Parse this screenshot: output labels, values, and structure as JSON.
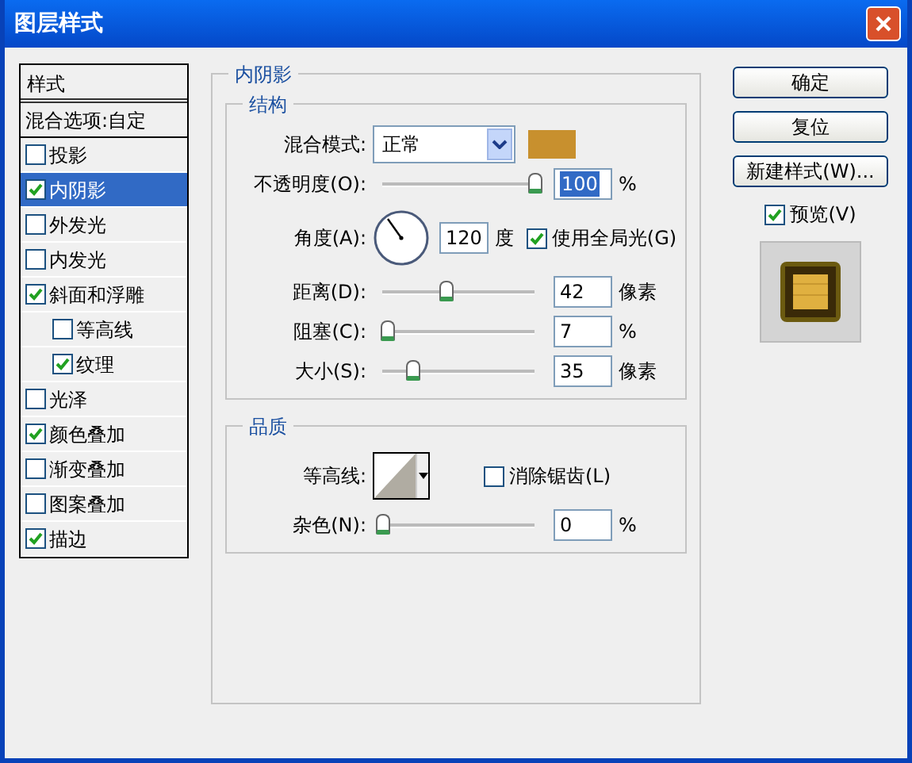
{
  "window": {
    "title": "图层样式"
  },
  "styles_list": {
    "header": "样式",
    "items": [
      {
        "label": "混合选项:自定",
        "kind": "plain",
        "selected": false
      },
      {
        "label": "投影",
        "kind": "check",
        "checked": false,
        "selected": false
      },
      {
        "label": "内阴影",
        "kind": "check",
        "checked": true,
        "selected": true
      },
      {
        "label": "外发光",
        "kind": "check",
        "checked": false,
        "selected": false
      },
      {
        "label": "内发光",
        "kind": "check",
        "checked": false,
        "selected": false
      },
      {
        "label": "斜面和浮雕",
        "kind": "check",
        "checked": true,
        "selected": false,
        "children": [
          {
            "label": "等高线",
            "kind": "check",
            "checked": false,
            "selected": false
          },
          {
            "label": "纹理",
            "kind": "check",
            "checked": true,
            "selected": false
          }
        ]
      },
      {
        "label": "光泽",
        "kind": "check",
        "checked": false,
        "selected": false
      },
      {
        "label": "颜色叠加",
        "kind": "check",
        "checked": true,
        "selected": false
      },
      {
        "label": "渐变叠加",
        "kind": "check",
        "checked": false,
        "selected": false
      },
      {
        "label": "图案叠加",
        "kind": "check",
        "checked": false,
        "selected": false
      },
      {
        "label": "描边",
        "kind": "check",
        "checked": true,
        "selected": false
      }
    ]
  },
  "panel": {
    "title": "内阴影",
    "structure": {
      "title": "结构",
      "rows": [
        {
          "kind": "blend",
          "label": "混合模式:",
          "value": "正常",
          "color": "#c8902e"
        },
        {
          "kind": "slider",
          "label": "不透明度(O):",
          "level": 1.0,
          "value": "100",
          "unit": "%"
        },
        {
          "kind": "angle",
          "label": "角度(A):",
          "value": "120",
          "unit": "度",
          "checkbox": {
            "label": "使用全局光(G)",
            "checked": true
          }
        },
        {
          "kind": "slider",
          "label": "距离(D):",
          "level": 0.42,
          "value": "42",
          "unit": "像素"
        },
        {
          "kind": "slider",
          "label": "阻塞(C):",
          "level": 0.03,
          "value": "7",
          "unit": "%"
        },
        {
          "kind": "slider",
          "label": "大小(S):",
          "level": 0.2,
          "value": "35",
          "unit": "像素"
        }
      ]
    },
    "quality": {
      "title": "品质",
      "rows": [
        {
          "kind": "contour",
          "label": "等高线:",
          "checkbox": {
            "label": "消除锯齿(L)",
            "checked": false
          }
        },
        {
          "kind": "slider",
          "label": "杂色(N):",
          "level": 0.0,
          "value": "0",
          "unit": "%"
        }
      ]
    }
  },
  "buttons": [
    "确定",
    "复位",
    "新建样式(W)..."
  ],
  "preview": {
    "label": "预览(V)",
    "checked": true
  }
}
